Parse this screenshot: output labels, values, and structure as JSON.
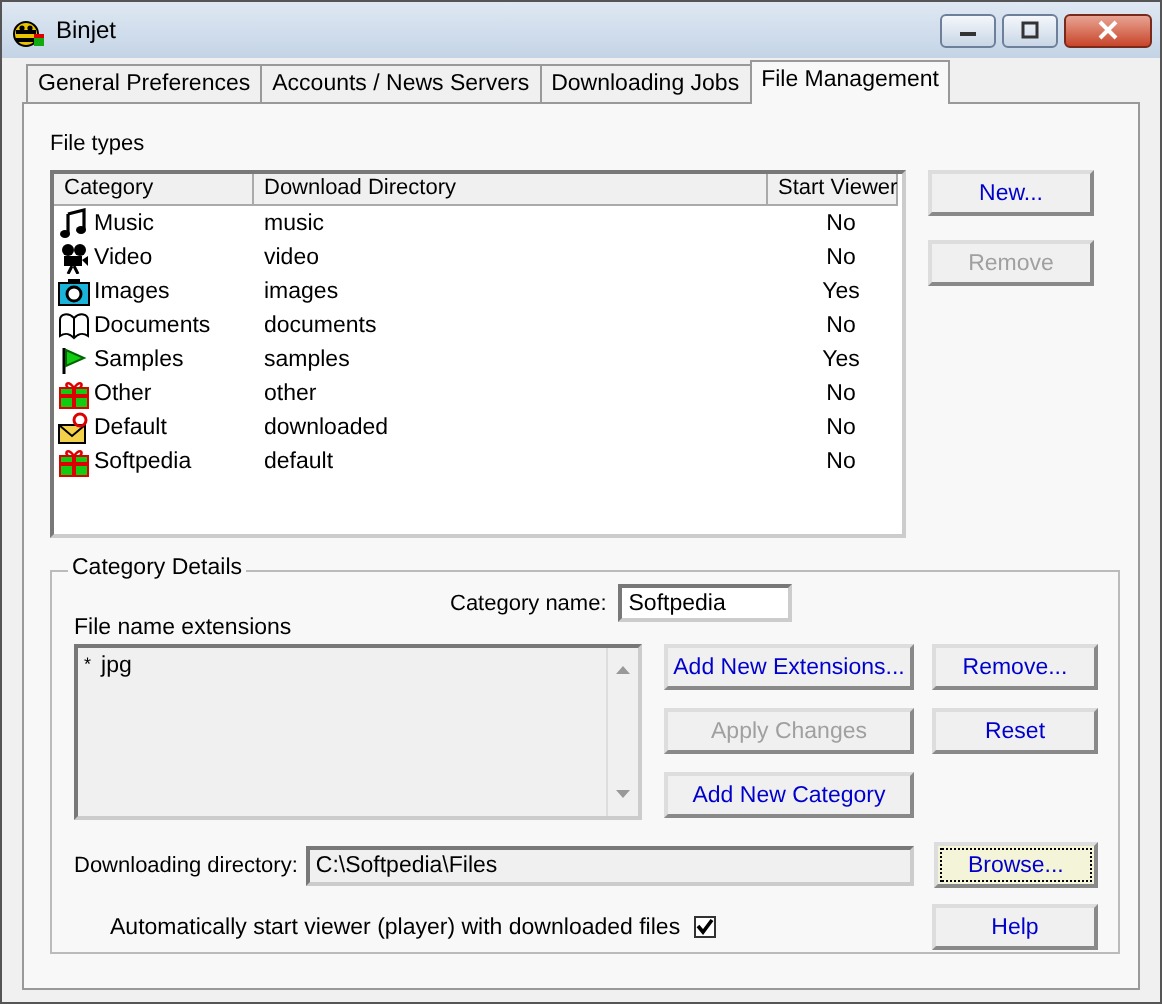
{
  "window": {
    "title": "Binjet"
  },
  "tabs": [
    {
      "label": "General Preferences",
      "selected": false
    },
    {
      "label": "Accounts / News Servers",
      "selected": false
    },
    {
      "label": "Downloading Jobs",
      "selected": false
    },
    {
      "label": "File Management",
      "selected": true
    }
  ],
  "file_types": {
    "label": "File types",
    "columns": [
      "Category",
      "Download Directory",
      "Start Viewer"
    ],
    "rows": [
      {
        "category": "Music",
        "directory": "music",
        "start_viewer": "No"
      },
      {
        "category": "Video",
        "directory": "video",
        "start_viewer": "No"
      },
      {
        "category": "Images",
        "directory": "images",
        "start_viewer": "Yes"
      },
      {
        "category": "Documents",
        "directory": "documents",
        "start_viewer": "No"
      },
      {
        "category": "Samples",
        "directory": "samples",
        "start_viewer": "Yes"
      },
      {
        "category": "Other",
        "directory": "other",
        "start_viewer": "No"
      },
      {
        "category": "Default",
        "directory": "downloaded",
        "start_viewer": "No"
      },
      {
        "category": "Softpedia",
        "directory": "default",
        "start_viewer": "No"
      }
    ],
    "buttons": [
      {
        "label": "New...",
        "disabled": false
      },
      {
        "label": "Remove",
        "disabled": true
      }
    ]
  },
  "category_details": {
    "title": "Category Details",
    "category_name_label": "Category name:",
    "category_name": "Softpedia",
    "extensions_label": "File name extensions",
    "extensions": [
      {
        "marker": "*",
        "text": "jpg"
      }
    ],
    "buttons": [
      {
        "label": "Add New Extensions...",
        "disabled": false
      },
      {
        "label": "Remove...",
        "disabled": false
      },
      {
        "label": "Apply Changes",
        "disabled": true
      },
      {
        "label": "Reset",
        "disabled": false
      },
      {
        "label": "Add New Category",
        "disabled": false
      }
    ],
    "directory_label": "Downloading directory:",
    "directory": "C:\\Softpedia\\Files",
    "browse": {
      "label": "Browse...",
      "focused": true
    },
    "auto_start": {
      "label": "Automatically start viewer (player) with downloaded files",
      "checked": true
    },
    "help": "Help"
  }
}
